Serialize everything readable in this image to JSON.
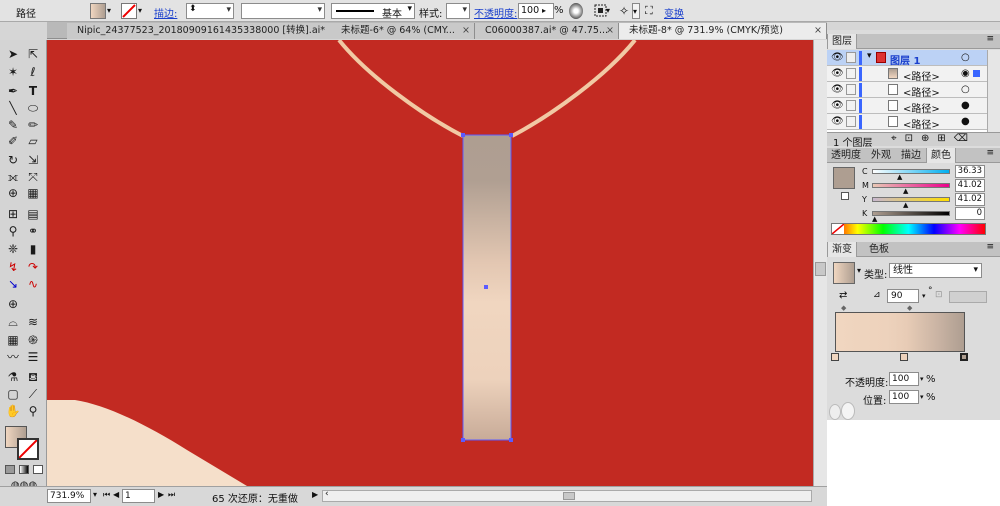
{
  "control_bar": {
    "object_type": "路径",
    "stroke_label": "描边:",
    "stroke_style": "基本",
    "style_label": "样式:",
    "opacity_label": "不透明度:",
    "opacity_value": "100",
    "opacity_unit": "%",
    "transform_label": "变换"
  },
  "tabs": [
    {
      "label": "Nipic_24377523_20180909161435338000 [转换].ai*",
      "active": false
    },
    {
      "label": "未标题-6* @ 64% (CMY...",
      "active": false
    },
    {
      "label": "C06000387.ai* @ 47.75...",
      "active": false
    },
    {
      "label": "未标题-8* @ 731.9% (CMYK/预览)",
      "active": true
    }
  ],
  "status_bar": {
    "zoom": "731.9%",
    "page": "1",
    "history": "65 次还原：无重做"
  },
  "layers_panel": {
    "title": "图层",
    "layer_name": "图层 1",
    "paths": [
      "<路径>",
      "<路径>",
      "<路径>",
      "<路径>"
    ],
    "layer_count": "1 个图层"
  },
  "color_panel": {
    "tabs": [
      "透明度",
      "外观",
      "描边",
      "颜色"
    ],
    "active_tab": "颜色",
    "channels": [
      {
        "name": "C",
        "value": "36.33"
      },
      {
        "name": "M",
        "value": "41.02"
      },
      {
        "name": "Y",
        "value": "41.02"
      },
      {
        "name": "K",
        "value": "0"
      }
    ]
  },
  "gradient_panel": {
    "tabs": [
      "渐变",
      "色板"
    ],
    "active_tab": "渐变",
    "type_label": "类型:",
    "type_value": "线性",
    "angle": "90",
    "angle_unit": "°",
    "opacity_label": "不透明度:",
    "opacity_value": "100",
    "position_label": "位置:",
    "position_value": "100",
    "percent": "%"
  },
  "colors": {
    "canvas_bg": "#c22a22",
    "cord": "#f1c9a4",
    "bar_top": "#ae9e91",
    "bar_mid": "#f0d6c0",
    "bar_bottom": "#c8ab98",
    "selection": "#5b5bff",
    "bottom_shape": "#f5dfca"
  },
  "icons": {
    "tools": [
      "selection-tool-icon",
      "direct-selection-tool-icon",
      "magic-wand-tool-icon",
      "lasso-tool-icon",
      "pen-tool-icon",
      "type-tool-icon",
      "line-tool-icon",
      "ellipse-tool-icon",
      "paintbrush-tool-icon",
      "pencil-tool-icon",
      "blob-brush-tool-icon",
      "eraser-tool-icon",
      "rotate-tool-icon",
      "scale-tool-icon",
      "width-tool-icon",
      "free-transform-tool-icon",
      "shape-builder-tool-icon",
      "perspective-grid-tool-icon",
      "mesh-tool-icon",
      "gradient-tool-icon",
      "eyedropper-tool-icon",
      "blend-tool-icon",
      "symbol-sprayer-tool-icon",
      "column-graph-tool-icon",
      "artboard-tool-icon",
      "slice-tool-icon",
      "hand-tool-icon",
      "zoom-tool-icon"
    ]
  }
}
